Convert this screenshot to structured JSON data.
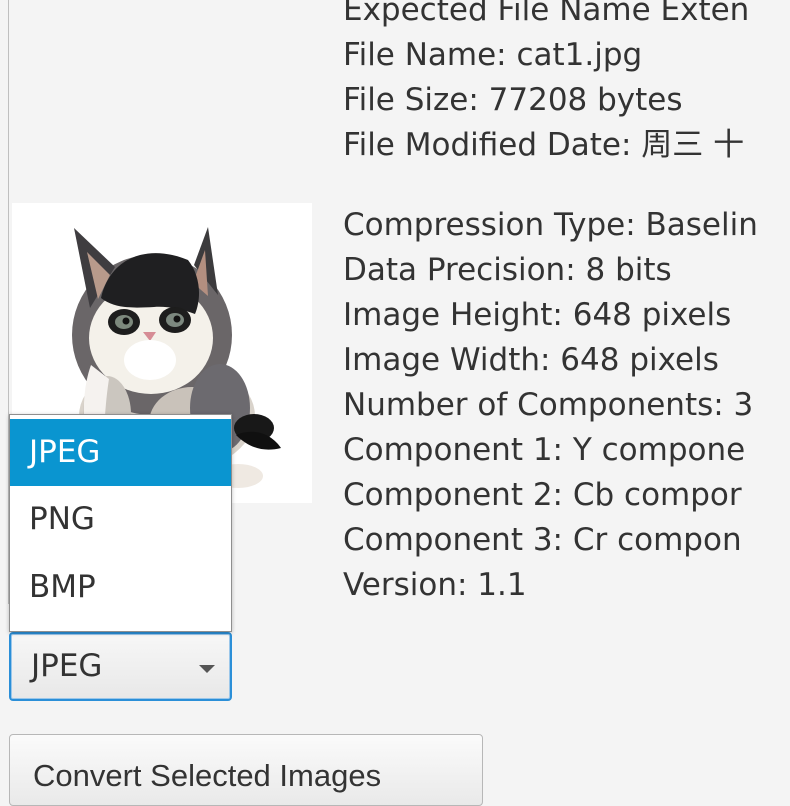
{
  "metadata_lines": {
    "expected_extension": "Expected File Name Exten",
    "file_name": "File Name: cat1.jpg",
    "file_size": "File Size: 77208 bytes",
    "file_modified_date": "File Modified Date: 周三 十"
  },
  "image_lines": {
    "compression_type": "Compression Type: Baselin",
    "data_precision": "Data Precision: 8 bits",
    "image_height": "Image Height: 648 pixels",
    "image_width": "Image Width: 648 pixels",
    "component_count": "Number of Components: 3",
    "component_1": "Component 1: Y compone",
    "component_2": "Component 2: Cb compor",
    "component_3": "Component 3: Cr compon",
    "version": "Version: 1.1"
  },
  "format_selector": {
    "selected_value": "JPEG",
    "options": [
      "JPEG",
      "PNG",
      "BMP"
    ]
  },
  "actions": {
    "convert_label": "Convert Selected Images"
  },
  "icons": {
    "dropdown_arrow": "chevron-down-icon"
  },
  "colors": {
    "selection_blue": "#0a95d0",
    "focus_blue": "#2b8fd8"
  }
}
